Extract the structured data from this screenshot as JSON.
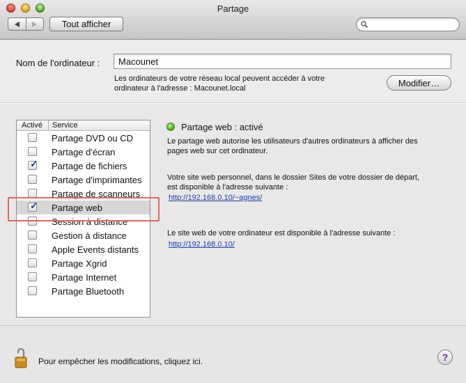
{
  "window": {
    "title": "Partage"
  },
  "toolbar": {
    "show_all_label": "Tout afficher",
    "back_icon": "back-arrow-icon",
    "forward_icon": "forward-arrow-icon",
    "search_placeholder": ""
  },
  "computer_name": {
    "label": "Nom de l'ordinateur :",
    "value": "Macounet",
    "help_line1": "Les ordinateurs de votre réseau local peuvent accéder à votre",
    "help_line2": "ordinateur à l'adresse : Macounet.local",
    "modify_label": "Modifier…"
  },
  "services": {
    "headers": {
      "active": "Activé",
      "service": "Service"
    },
    "items": [
      {
        "label": "Partage DVD ou CD",
        "checked": false
      },
      {
        "label": "Partage d'écran",
        "checked": false
      },
      {
        "label": "Partage de fichiers",
        "checked": true
      },
      {
        "label": "Partage d'imprimantes",
        "checked": false
      },
      {
        "label": "Partage de scanneurs",
        "checked": false
      },
      {
        "label": "Partage web",
        "checked": true,
        "selected": true
      },
      {
        "label": "Session à distance",
        "checked": false
      },
      {
        "label": "Gestion à distance",
        "checked": false
      },
      {
        "label": "Apple Events distants",
        "checked": false
      },
      {
        "label": "Partage Xgrid",
        "checked": false
      },
      {
        "label": "Partage Internet",
        "checked": false
      },
      {
        "label": "Partage Bluetooth",
        "checked": false
      }
    ]
  },
  "detail": {
    "status": "Partage web : activé",
    "status_color": "#3f9f1c",
    "desc_line1": "Le partage web autorise les utilisateurs d'autres ordinateurs à afficher des",
    "desc_line2": "pages web sur cet ordinateur.",
    "personal_line1": "Votre site web personnel, dans le dossier Sites de votre dossier de départ,",
    "personal_line2": "est disponible à l'adresse suivante :",
    "personal_url": "http://192.168.0.10/~agnes/",
    "computer_line": "Le site web de votre ordinateur est disponible à l'adresse suivante :",
    "computer_url": "http://192.168.0.10/"
  },
  "footer": {
    "lock_text": "Pour empêcher les modifications, cliquez ici.",
    "help_label": "?"
  }
}
